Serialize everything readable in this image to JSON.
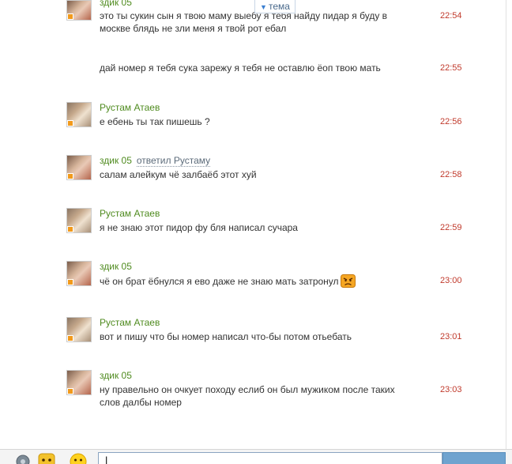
{
  "topic_tab": {
    "label": "тема",
    "arrow": "▼"
  },
  "messages": [
    {
      "author": "здик 05",
      "reply": "",
      "lines": [
        "это ты сукин сын я твою маму выебу я тебя найду пидар я буду в",
        "москве блядь не зли меня я твой рот ебал"
      ],
      "time": "22:54",
      "avatar": "zdik"
    },
    {
      "author": "",
      "reply": "",
      "lines": [
        "дай номер я тебя сука зарежу я тебя не оставлю ёоп твою мать"
      ],
      "time": "22:55",
      "avatar": ""
    },
    {
      "author": "Рустам Атаев",
      "reply": "",
      "lines": [
        "е ебень ты так пишешь ?"
      ],
      "time": "22:56",
      "avatar": "rustam"
    },
    {
      "author": "здик 05",
      "reply": "ответил Рустаму",
      "lines": [
        "салам алейкум чё залбаёб этот хуй"
      ],
      "time": "22:58",
      "avatar": "zdik"
    },
    {
      "author": "Рустам Атаев",
      "reply": "",
      "lines": [
        "я не знаю этот пидор фу бля написал сучара"
      ],
      "time": "22:59",
      "avatar": "rustam"
    },
    {
      "author": "здик 05",
      "reply": "",
      "lines": [
        "чё он брат ёбнулся я ево даже не знаю мать затронул"
      ],
      "time": "23:00",
      "avatar": "zdik",
      "emoticon": "angry-smiley"
    },
    {
      "author": "Рустам Атаев",
      "reply": "",
      "lines": [
        "вот и пишу что бы номер написал что-бы потом отьебать"
      ],
      "time": "23:01",
      "avatar": "rustam"
    },
    {
      "author": "здик 05",
      "reply": "",
      "lines": [
        "ну правельно он очкует походу еслиб он был мужиком после таких",
        "слов далбы номер"
      ],
      "time": "23:03",
      "avatar": "zdik"
    }
  ],
  "input": {
    "value": "",
    "cursor": "|"
  },
  "toolbar_icons": [
    "settings-icon",
    "gift-smiley-icon",
    "smiley-icon"
  ],
  "colors": {
    "author": "#4f8b1f",
    "time": "#c0392b",
    "status": "#f29a1c",
    "send": "#6fa3cf"
  }
}
